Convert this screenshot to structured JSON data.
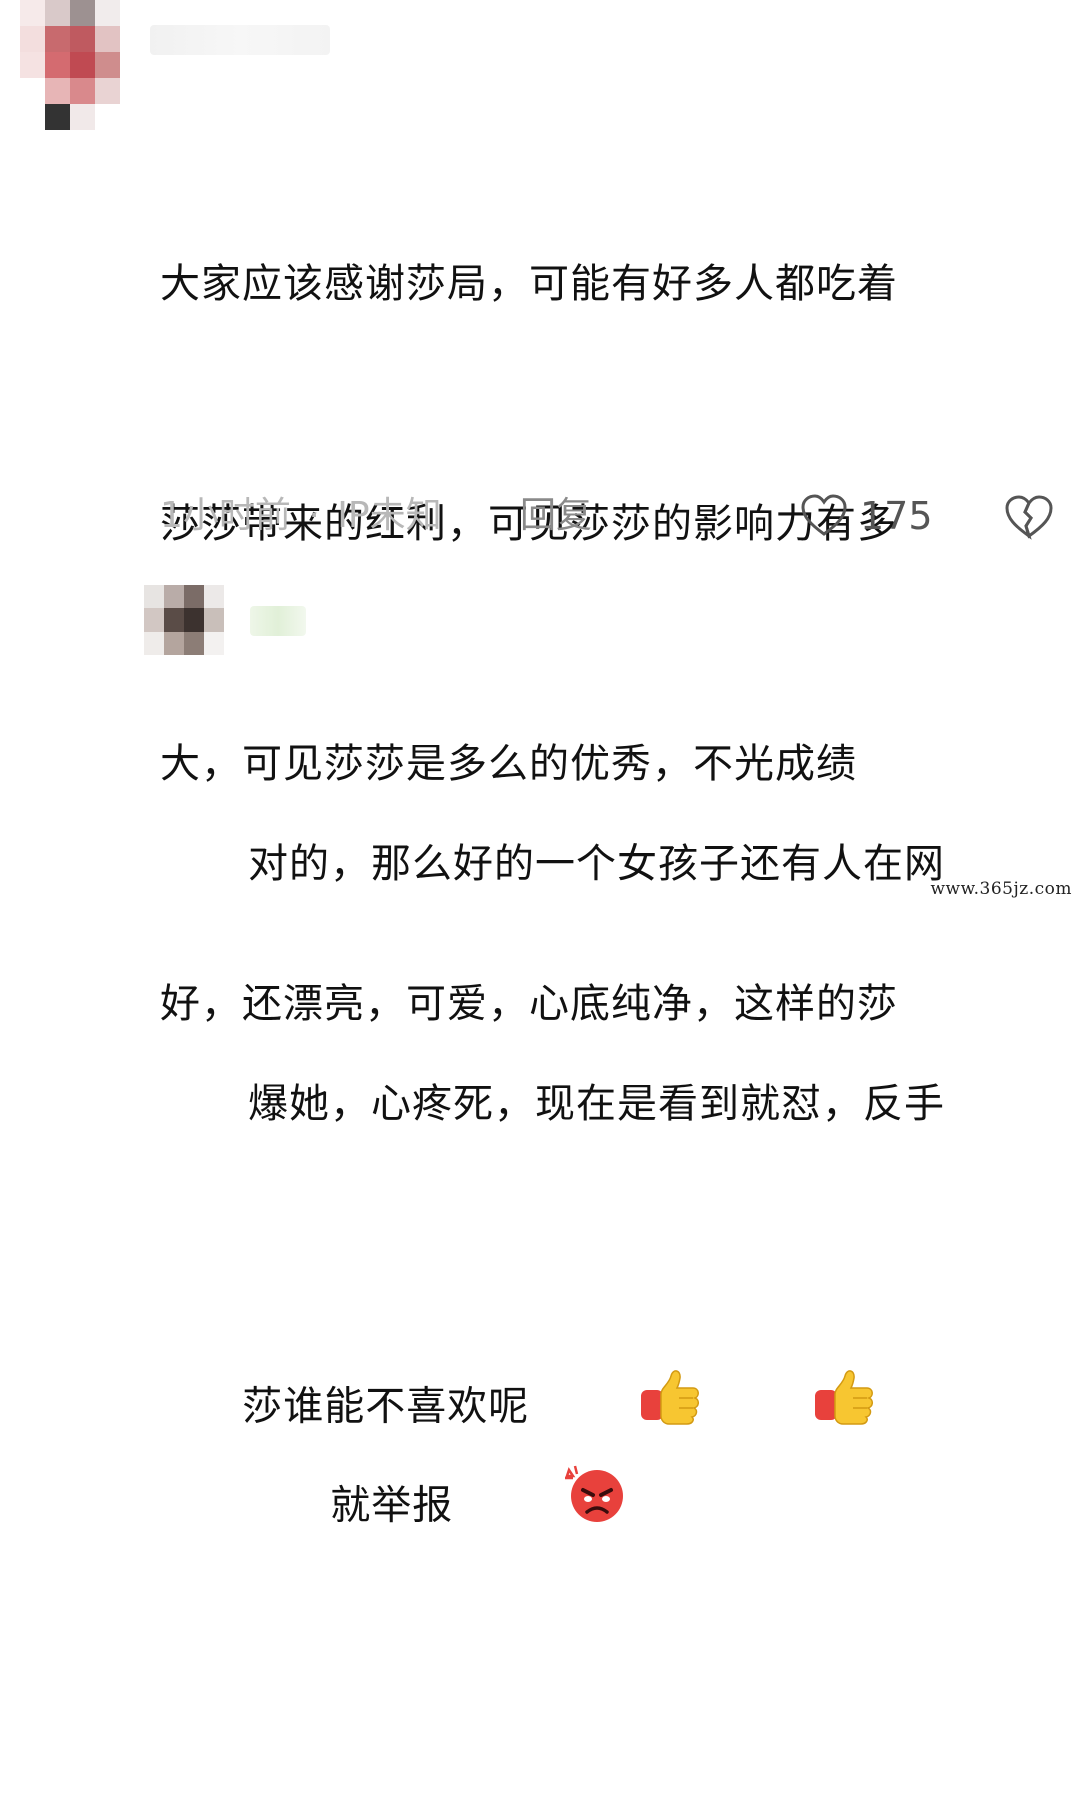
{
  "comment": {
    "lines": [
      "大家应该感谢莎局，可能有好多人都吃着",
      "莎莎带来的红利，可见莎莎的影响力有多",
      "大，可见莎莎是多么的优秀，不光成绩",
      "好，还漂亮，可爱，心底纯净，这样的莎",
      "莎谁能不喜欢呢"
    ],
    "emoji": "thumbs-up-icon",
    "time": "1小时前",
    "separator": "·",
    "ip": "IP未知",
    "reply_label": "回复",
    "like_count": "175"
  },
  "reply": {
    "lines": [
      "对的，那么好的一个女孩子还有人在网",
      "爆她，心疼死，现在是看到就怼，反手",
      "就举报"
    ],
    "emoji": "angry-face-icon"
  },
  "watermark": "www.365jz.com",
  "colors": {
    "text": "#111111",
    "meta": "#b8b8b8",
    "reply_action": "#8a8a8a",
    "thumb_yellow": "#f7c631",
    "thumb_cuff": "#e8413c",
    "angry_red": "#e8413c"
  }
}
